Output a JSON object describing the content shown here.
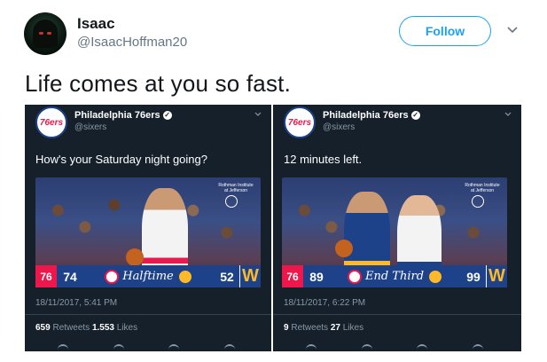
{
  "tweet": {
    "author_name": "Isaac",
    "author_handle": "@IsaacHoffman20",
    "follow_label": "Follow",
    "text": "Life comes at you so fast."
  },
  "screenshots": [
    {
      "account_name": "Philadelphia 76ers",
      "account_handle": "@sixers",
      "text": "How's your Saturday night going?",
      "score_home": "74",
      "period": "Halftime",
      "score_away": "52",
      "timestamp": "18/11/2017, 5:41 PM",
      "retweets": "659",
      "retweets_label": "Retweets",
      "likes": "1.553",
      "likes_label": "Likes"
    },
    {
      "account_name": "Philadelphia 76ers",
      "account_handle": "@sixers",
      "text": "12 minutes left.",
      "score_home": "89",
      "period": "End Third",
      "score_away": "99",
      "timestamp": "18/11/2017, 6:22 PM",
      "retweets": "9",
      "retweets_label": "Retweets",
      "likes": "27",
      "likes_label": "Likes"
    }
  ],
  "logos": {
    "sixers_logo_text": "76ers",
    "sixers_scorebar_text": "76",
    "warriors_scorebar_text": "W"
  },
  "sponsor_text": "Rothman Institute at Jefferson",
  "colors": {
    "follow_blue": "#1da1f2",
    "dark_bg": "#15202b",
    "sixers_blue": "#1d428a",
    "sixers_red": "#ed174c",
    "warriors_gold": "#fdb927"
  }
}
